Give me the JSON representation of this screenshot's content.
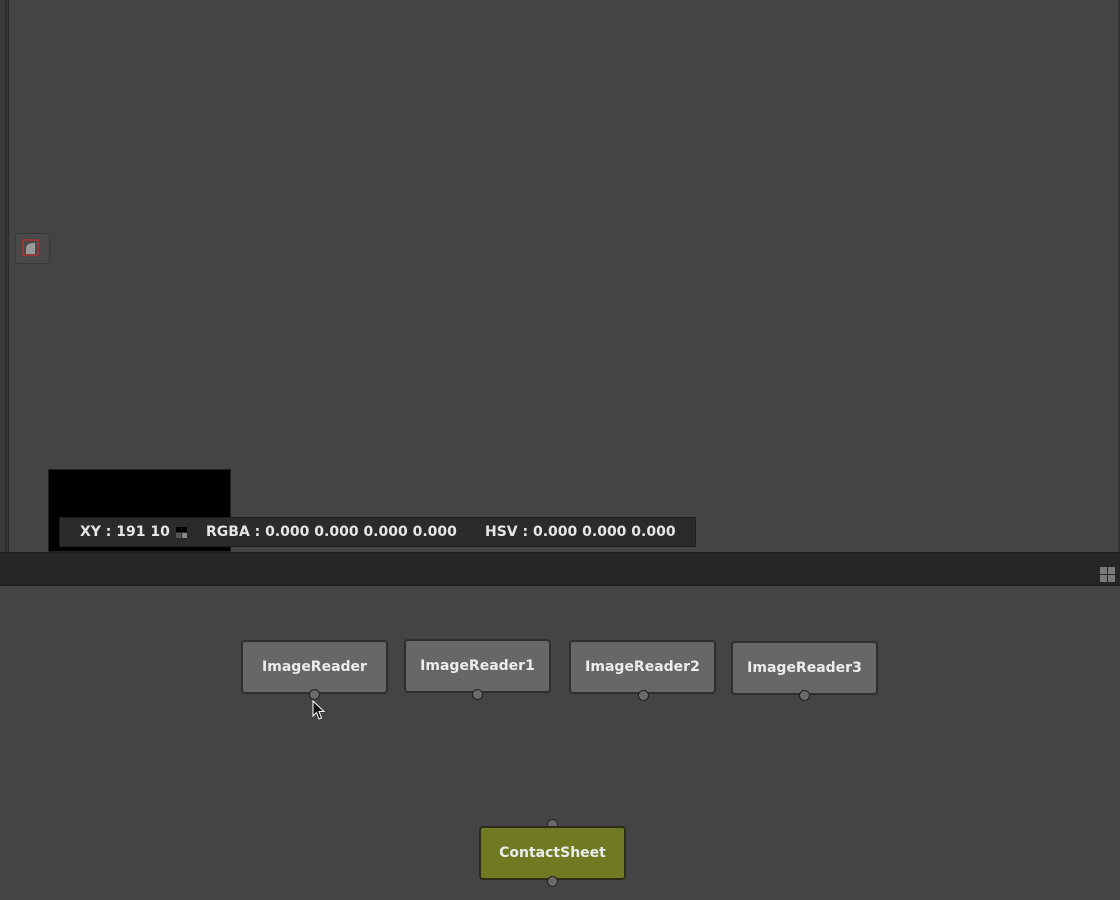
{
  "viewer": {
    "info": {
      "xy": "XY : 191 10",
      "rgba": "RGBA : 0.000 0.000 0.000 0.000",
      "hsv": "HSV : 0.000 0.000 0.000"
    },
    "roi_icon": "region-of-interest-icon"
  },
  "splitter": {
    "icon": "layout-grid-icon"
  },
  "nodegraph": {
    "nodes": [
      {
        "label": "ImageReader"
      },
      {
        "label": "ImageReader1"
      },
      {
        "label": "ImageReader2"
      },
      {
        "label": "ImageReader3"
      },
      {
        "label": "ContactSheet"
      }
    ]
  },
  "colors": {
    "background": "#444444",
    "node_default": "#676767",
    "node_contactsheet": "#6f7a22",
    "info_bar": "#2b2b2b"
  }
}
